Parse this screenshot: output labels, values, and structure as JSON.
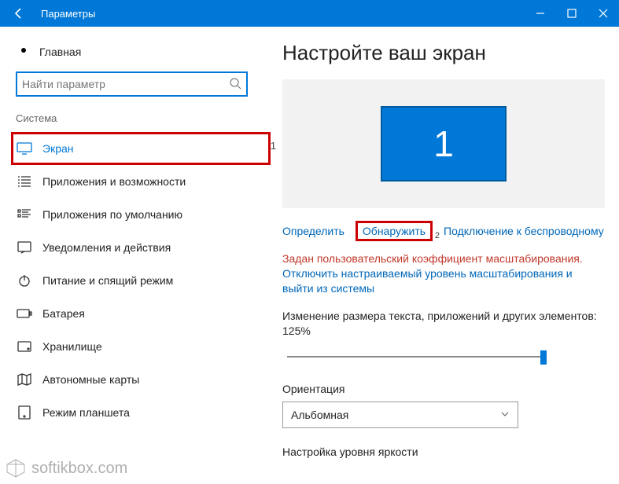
{
  "titlebar": {
    "title": "Параметры"
  },
  "sidebar": {
    "home": "Главная",
    "search_placeholder": "Найти параметр",
    "category": "Система",
    "items": [
      {
        "label": "Экран"
      },
      {
        "label": "Приложения и возможности"
      },
      {
        "label": "Приложения по умолчанию"
      },
      {
        "label": "Уведомления и действия"
      },
      {
        "label": "Питание и спящий режим"
      },
      {
        "label": "Батарея"
      },
      {
        "label": "Хранилище"
      },
      {
        "label": "Автономные карты"
      },
      {
        "label": "Режим планшета"
      }
    ]
  },
  "main": {
    "heading": "Настройте ваш экран",
    "monitor_number": "1",
    "link_identify": "Определить",
    "link_detect": "Обнаружить",
    "link_wireless": "Подключение к беспроводному",
    "warning": "Задан пользовательский коэффициент масштабирования.",
    "turnoff_link": "Отключить настраиваемый уровень масштабирования и выйти из системы",
    "scale_label": "Изменение размера текста, приложений и других элементов: 125%",
    "orientation_label": "Ориентация",
    "orientation_value": "Альбомная",
    "brightness_label": "Настройка уровня яркости"
  },
  "annotations": {
    "one": "1",
    "two": "2"
  },
  "watermark": "softikbox.com"
}
